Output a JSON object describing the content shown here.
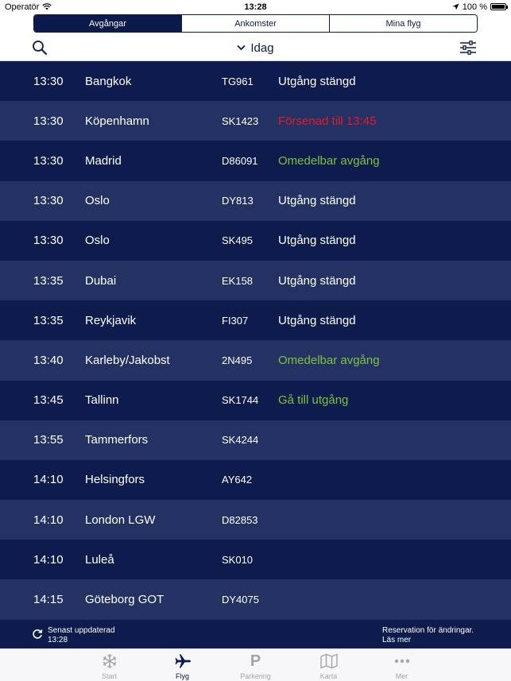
{
  "status_bar": {
    "carrier": "Operatör",
    "time": "13:28",
    "battery": "100 %"
  },
  "tabs": [
    {
      "label": "Avgångar",
      "active": true
    },
    {
      "label": "Ankomster",
      "active": false
    },
    {
      "label": "Mina flyg",
      "active": false
    }
  ],
  "toolbar": {
    "date_label": "Idag",
    "search_icon": "search-icon",
    "filter_icon": "filter-icon"
  },
  "flights": [
    {
      "time": "13:30",
      "destination": "Bangkok",
      "flight": "TG961",
      "status": "Utgång stängd",
      "status_color": "#ffffff"
    },
    {
      "time": "13:30",
      "destination": "Köpenhamn",
      "flight": "SK1423",
      "status": "Försenad till 13:45",
      "status_color": "#e4192c"
    },
    {
      "time": "13:30",
      "destination": "Madrid",
      "flight": "D86091",
      "status": "Omedelbar avgång",
      "status_color": "#7cc33d"
    },
    {
      "time": "13:30",
      "destination": "Oslo",
      "flight": "DY813",
      "status": "Utgång stängd",
      "status_color": "#ffffff"
    },
    {
      "time": "13:30",
      "destination": "Oslo",
      "flight": "SK495",
      "status": "Utgång stängd",
      "status_color": "#ffffff"
    },
    {
      "time": "13:35",
      "destination": "Dubai",
      "flight": "EK158",
      "status": "Utgång stängd",
      "status_color": "#ffffff"
    },
    {
      "time": "13:35",
      "destination": "Reykjavik",
      "flight": "FI307",
      "status": "Utgång stängd",
      "status_color": "#ffffff"
    },
    {
      "time": "13:40",
      "destination": "Karleby/Jakobst",
      "flight": "2N495",
      "status": "Omedelbar avgång",
      "status_color": "#7cc33d"
    },
    {
      "time": "13:45",
      "destination": "Tallinn",
      "flight": "SK1744",
      "status": "Gå till utgång",
      "status_color": "#7cc33d"
    },
    {
      "time": "13:55",
      "destination": "Tammerfors",
      "flight": "SK4244",
      "status": "",
      "status_color": "#ffffff"
    },
    {
      "time": "14:10",
      "destination": "Helsingfors",
      "flight": "AY642",
      "status": "",
      "status_color": "#ffffff"
    },
    {
      "time": "14:10",
      "destination": "London LGW",
      "flight": "D82853",
      "status": "",
      "status_color": "#ffffff"
    },
    {
      "time": "14:10",
      "destination": "Luleå",
      "flight": "SK010",
      "status": "",
      "status_color": "#ffffff"
    },
    {
      "time": "14:15",
      "destination": "Göteborg GOT",
      "flight": "DY4075",
      "status": "",
      "status_color": "#ffffff"
    }
  ],
  "update_bar": {
    "updated_label": "Senast uppdaterad",
    "updated_time": "13:28",
    "reservation_line1": "Reservation för ändringar.",
    "reservation_line2": "Läs mer"
  },
  "tabbar": [
    {
      "label": "Start",
      "icon": "snowflake-icon",
      "active": false
    },
    {
      "label": "Flyg",
      "icon": "airplane-icon",
      "active": true
    },
    {
      "label": "Parkering",
      "icon": "parking-icon",
      "active": false
    },
    {
      "label": "Karta",
      "icon": "map-icon",
      "active": false
    },
    {
      "label": "Mer",
      "icon": "more-icon",
      "active": false
    }
  ],
  "colors": {
    "navy": "#0d1b4d",
    "navy_alt": "#243263",
    "delayed": "#e4192c",
    "boarding": "#7cc33d"
  }
}
